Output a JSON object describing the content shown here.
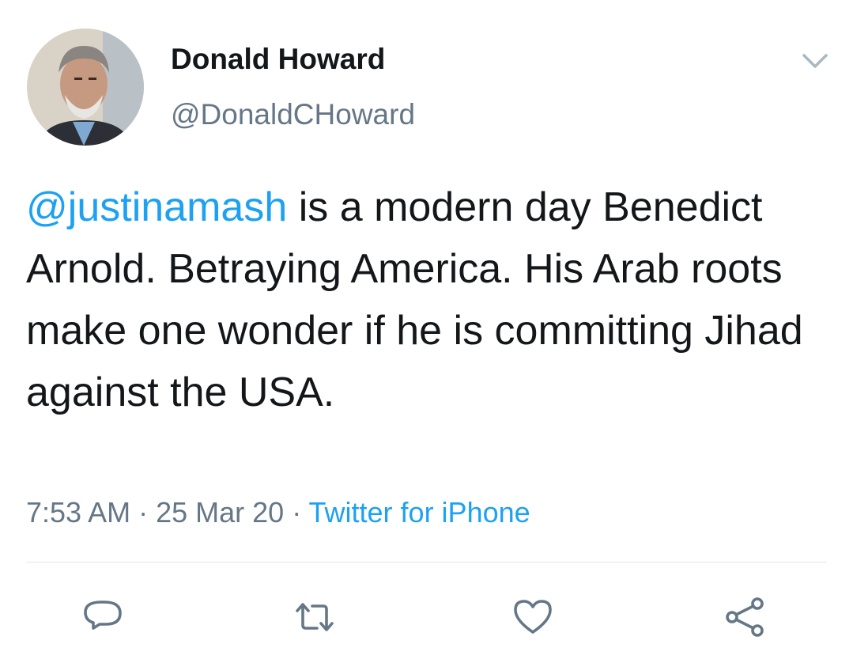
{
  "tweet": {
    "author": {
      "display_name": "Donald Howard",
      "handle": "@DonaldCHoward"
    },
    "text": {
      "mention": "@justinamash",
      "body": " is a modern day Benedict Arnold. Betraying America. His Arab roots make one wonder if he is committing Jihad against the USA."
    },
    "meta": {
      "time": "7:53 AM",
      "separator": " · ",
      "date": "25 Mar 20",
      "source": "Twitter for iPhone"
    }
  },
  "icons": {
    "menu": "chevron-down-icon",
    "reply": "reply-icon",
    "retweet": "retweet-icon",
    "like": "like-icon",
    "share": "share-icon"
  },
  "colors": {
    "text": "#14171a",
    "secondary": "#657786",
    "link": "#1da1f2",
    "divider": "#e1e8ed",
    "icon": "#657786"
  }
}
